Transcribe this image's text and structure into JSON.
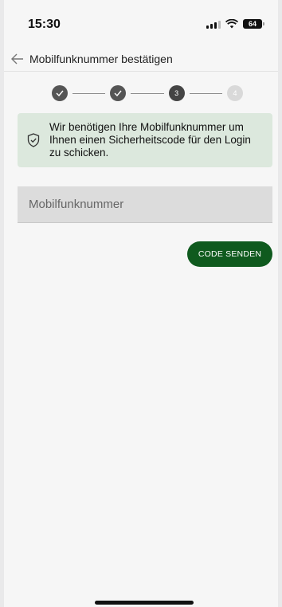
{
  "status_bar": {
    "time": "15:30",
    "battery": "64"
  },
  "app_bar": {
    "title": "Mobilfunknummer bestätigen"
  },
  "stepper": {
    "steps": [
      {
        "state": "done",
        "label": ""
      },
      {
        "state": "done",
        "label": ""
      },
      {
        "state": "active",
        "label": "3"
      },
      {
        "state": "pending",
        "label": "4"
      }
    ]
  },
  "info": {
    "text": "Wir benötigen Ihre Mobilfunknummer um Ihnen einen Sicherheitscode für den Login zu schicken.",
    "icon": "shield-check-icon"
  },
  "form": {
    "phone_placeholder": "Mobilfunknummer",
    "phone_value": "",
    "send_label": "CODE SENDEN"
  },
  "colors": {
    "primary": "#0f5a1e",
    "info_bg": "#dce8dd",
    "input_bg": "#dcdcdc"
  }
}
